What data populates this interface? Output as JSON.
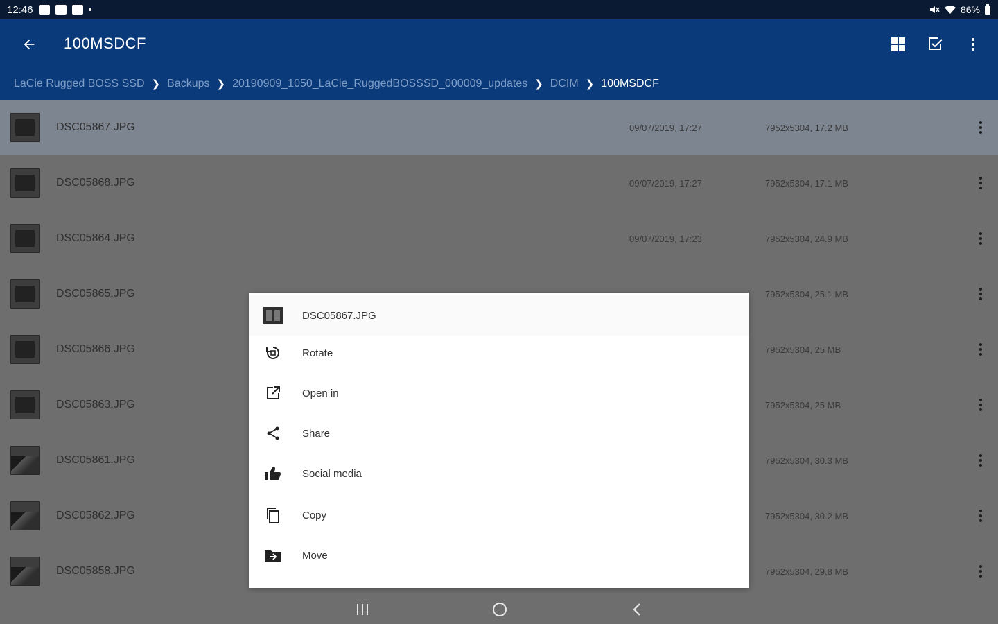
{
  "status_bar": {
    "time": "12:46",
    "battery": "86%"
  },
  "app_bar": {
    "title": "100MSDCF"
  },
  "breadcrumb": [
    "LaCie Rugged BOSS SSD",
    "Backups",
    "20190909_1050_LaCie_RuggedBOSSSD_000009_updates",
    "DCIM",
    "100MSDCF"
  ],
  "files": [
    {
      "name": "DSC05867.JPG",
      "date": "09/07/2019, 17:27",
      "size": "7952x5304, 17.2 MB",
      "selected": true,
      "thumb": "portrait"
    },
    {
      "name": "DSC05868.JPG",
      "date": "09/07/2019, 17:27",
      "size": "7952x5304, 17.1 MB",
      "thumb": "portrait"
    },
    {
      "name": "DSC05864.JPG",
      "date": "09/07/2019, 17:23",
      "size": "7952x5304, 24.9 MB",
      "thumb": "square"
    },
    {
      "name": "DSC05865.JPG",
      "date": "",
      "size": "7952x5304, 25.1 MB",
      "thumb": "square"
    },
    {
      "name": "DSC05866.JPG",
      "date": "",
      "size": "7952x5304, 25 MB",
      "thumb": "square"
    },
    {
      "name": "DSC05863.JPG",
      "date": "",
      "size": "7952x5304, 25 MB",
      "thumb": "square"
    },
    {
      "name": "DSC05861.JPG",
      "date": "",
      "size": "7952x5304, 30.3 MB",
      "thumb": "land"
    },
    {
      "name": "DSC05862.JPG",
      "date": "",
      "size": "7952x5304, 30.2 MB",
      "thumb": "land"
    },
    {
      "name": "DSC05858.JPG",
      "date": "",
      "size": "7952x5304, 29.8 MB",
      "thumb": "land"
    }
  ],
  "sheet": {
    "file_name": "DSC05867.JPG",
    "items": [
      {
        "label": "Rotate",
        "icon": "rotate-icon"
      },
      {
        "label": "Open in",
        "icon": "open-in-icon"
      },
      {
        "label": "Share",
        "icon": "share-icon"
      },
      {
        "label": "Social media",
        "icon": "thumbs-up-icon"
      },
      {
        "label": "Copy",
        "icon": "copy-icon"
      },
      {
        "label": "Move",
        "icon": "move-folder-icon"
      }
    ]
  },
  "colors": {
    "app_bar": "#0a3a7a",
    "status_bar": "#0a1a33",
    "scrim": "#6e6e6e",
    "selected_row": "#7d8591",
    "breadcrumb_inactive": "#7f9dc4"
  }
}
